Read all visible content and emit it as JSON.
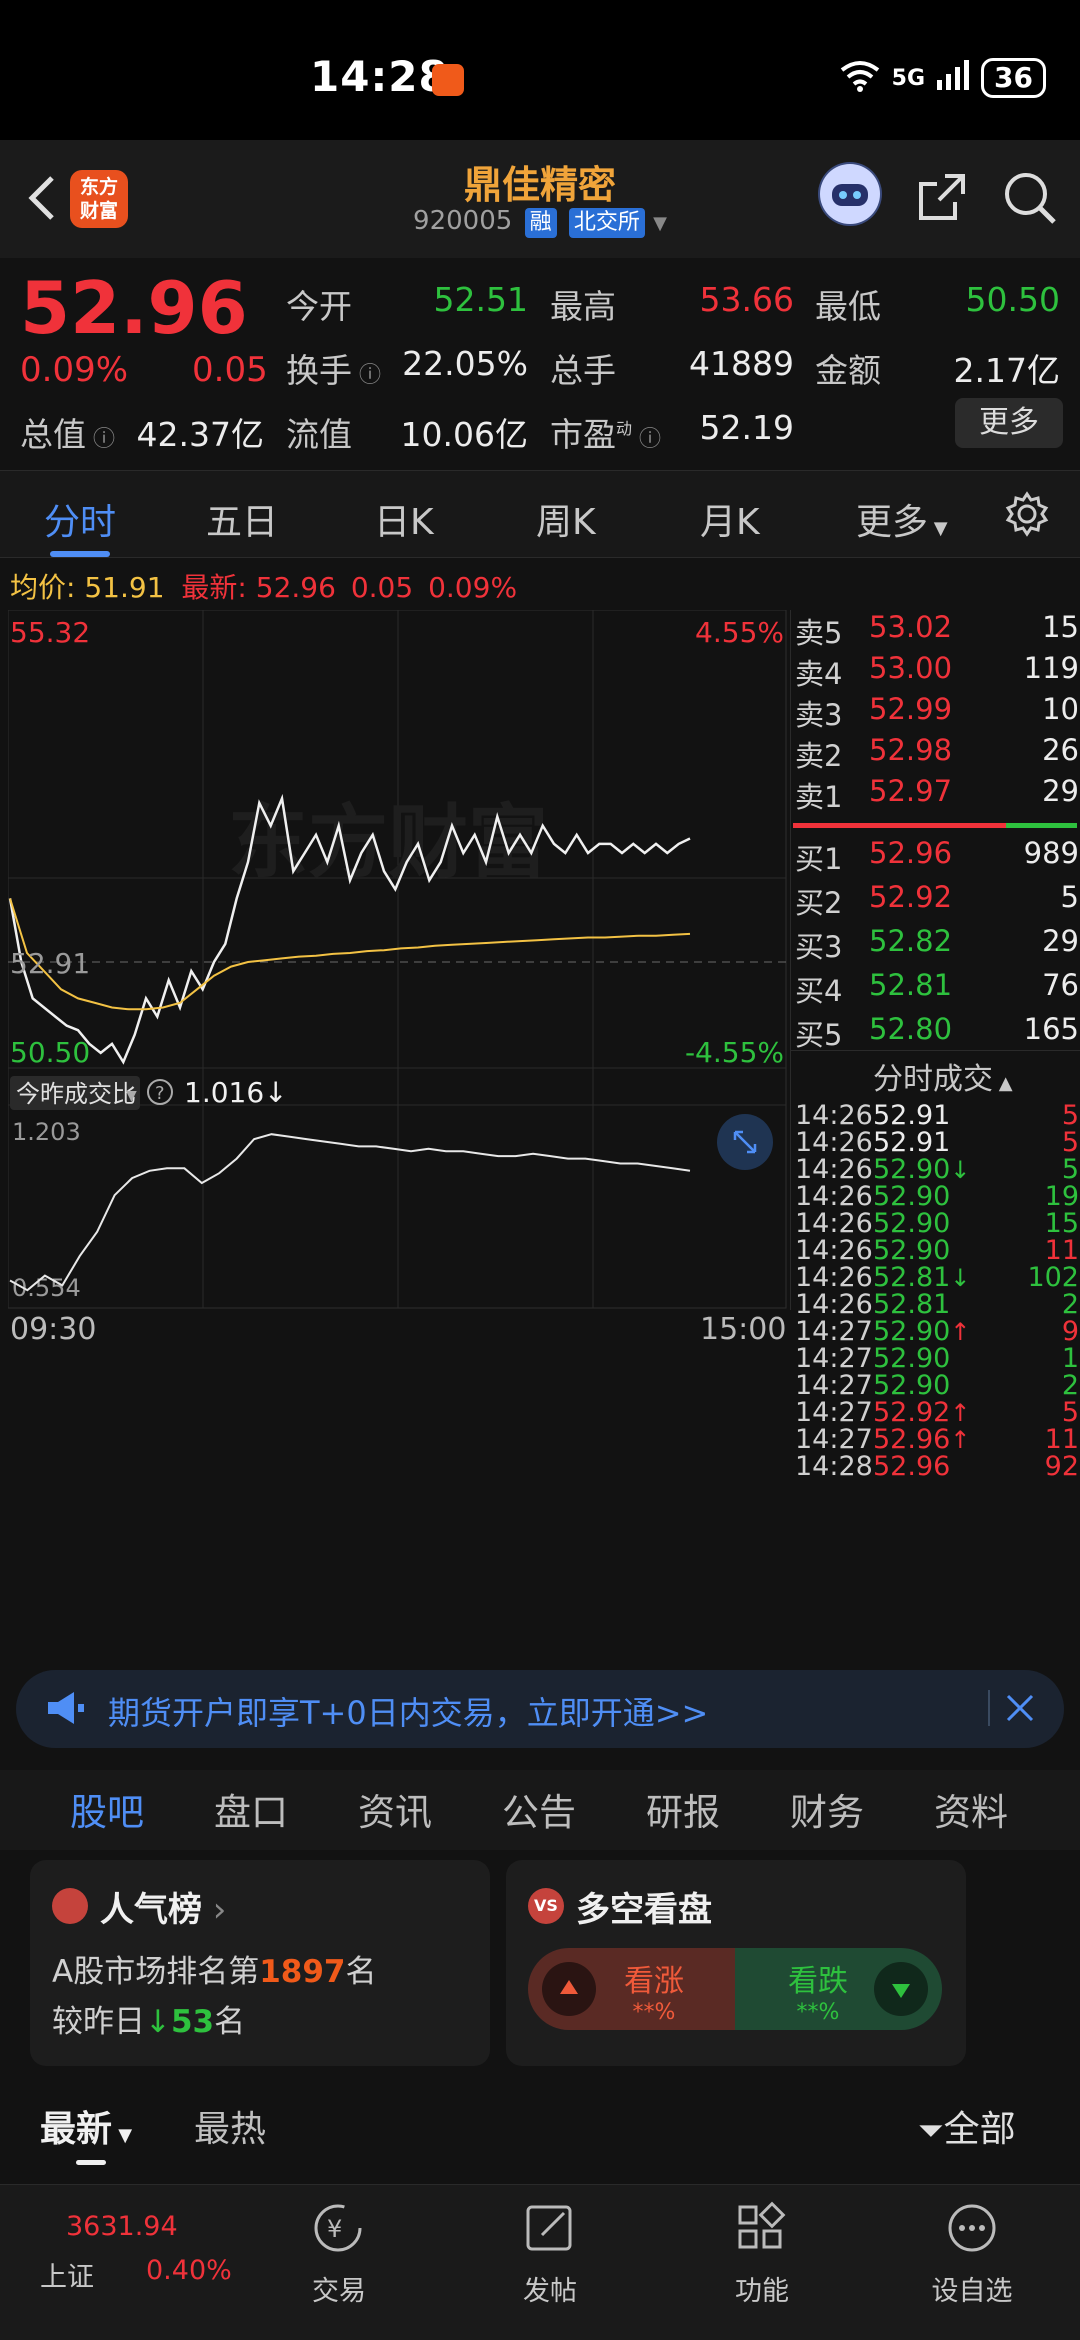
{
  "status_bar": {
    "time": "14:28",
    "network": "5G",
    "wifi_label": "6",
    "battery": "36"
  },
  "header": {
    "logo_text_1": "东方",
    "logo_text_2": "财富",
    "stock_name": "鼎佳精密",
    "stock_code": "920005",
    "tag_margin": "融",
    "tag_exchange": "北交所"
  },
  "quote": {
    "price": "52.96",
    "change_pct": "0.09%",
    "change": "0.05",
    "open_label": "今开",
    "open": "52.51",
    "high_label": "最高",
    "high": "53.66",
    "low_label": "最低",
    "low": "50.50",
    "turnover_label": "换手",
    "turnover": "22.05%",
    "volume_label": "总手",
    "volume": "41889",
    "amount_label": "金额",
    "amount": "2.17亿",
    "mktcap_label": "总值",
    "mktcap": "42.37亿",
    "float_label": "流值",
    "float_cap": "10.06亿",
    "pe_label": "市盈",
    "pe_sup": "动",
    "pe": "52.19",
    "more_label": "更多"
  },
  "chart_tabs": [
    "分时",
    "五日",
    "日K",
    "周K",
    "月K",
    "更多"
  ],
  "avg_bar": {
    "avg_label": "均价:",
    "avg": "51.91",
    "latest_label": "最新:",
    "latest": "52.96",
    "chg": "0.05",
    "pct": "0.09%"
  },
  "chart_data": {
    "type": "line",
    "title": "",
    "y_max_label": "55.32",
    "y_min_label": "50.50",
    "y_prev_close_label": "52.91",
    "pct_max_label": "4.55%",
    "pct_min_label": "-4.55%",
    "ylim": [
      50.5,
      55.32
    ],
    "x_start_label": "09:30",
    "x_end_label": "15:00",
    "series": [
      {
        "values": [
          52.3,
          51.6,
          51.2,
          51.1,
          51.0,
          50.9,
          50.85,
          50.7,
          50.6,
          50.7,
          50.5,
          50.8,
          51.2,
          51.0,
          51.4,
          51.1,
          51.5,
          51.3,
          51.6,
          51.8,
          52.3,
          52.7,
          53.35,
          53.1,
          53.4,
          52.6,
          52.8,
          53.0,
          52.7,
          53.1,
          52.5,
          52.8,
          53.0,
          52.6,
          52.4,
          52.7,
          52.9,
          52.5,
          52.7,
          53.1,
          52.8,
          53.0,
          52.7,
          53.2,
          52.8,
          53.0,
          52.8,
          53.1,
          52.9,
          52.8,
          53.0,
          52.8,
          52.9,
          52.9,
          52.8,
          52.9,
          52.8,
          52.9,
          52.8,
          52.9,
          52.96
        ]
      },
      {
        "values": [
          52.3,
          51.7,
          51.5,
          51.3,
          51.2,
          51.15,
          51.1,
          51.08,
          51.08,
          51.1,
          51.15,
          51.3,
          51.45,
          51.55,
          51.6,
          51.62,
          51.64,
          51.66,
          51.67,
          51.69,
          51.7,
          51.72,
          51.73,
          51.75,
          51.76,
          51.78,
          51.79,
          51.8,
          51.81,
          51.82,
          51.83,
          51.84,
          51.85,
          51.86,
          51.87,
          51.87,
          51.88,
          51.89,
          51.89,
          51.9,
          51.91
        ]
      }
    ]
  },
  "volume_ratio": {
    "label": "今昨成交比",
    "value": "1.016",
    "y_max_label": "1.203",
    "y_min_label": "0.554",
    "values": [
      0.6,
      0.56,
      0.62,
      0.58,
      0.7,
      0.8,
      0.95,
      1.02,
      1.05,
      1.06,
      1.06,
      1.0,
      1.04,
      1.1,
      1.18,
      1.2,
      1.19,
      1.18,
      1.17,
      1.16,
      1.15,
      1.15,
      1.14,
      1.13,
      1.14,
      1.13,
      1.13,
      1.12,
      1.11,
      1.11,
      1.12,
      1.11,
      1.1,
      1.1,
      1.09,
      1.08,
      1.08,
      1.07,
      1.06,
      1.05
    ]
  },
  "order_book": {
    "asks": [
      {
        "label": "卖5",
        "price": "53.02",
        "qty": "15"
      },
      {
        "label": "卖4",
        "price": "53.00",
        "qty": "119"
      },
      {
        "label": "卖3",
        "price": "52.99",
        "qty": "10"
      },
      {
        "label": "卖2",
        "price": "52.98",
        "qty": "26"
      },
      {
        "label": "卖1",
        "price": "52.97",
        "qty": "29"
      }
    ],
    "bids": [
      {
        "label": "买1",
        "price": "52.96",
        "qty": "989"
      },
      {
        "label": "买2",
        "price": "52.92",
        "qty": "5"
      },
      {
        "label": "买3",
        "price": "52.82",
        "qty": "29"
      },
      {
        "label": "买4",
        "price": "52.81",
        "qty": "76"
      },
      {
        "label": "买5",
        "price": "52.80",
        "qty": "165"
      }
    ],
    "ticks_title": "分时成交",
    "ticks": [
      {
        "time": "14:26",
        "price": "52.91",
        "arrow": "",
        "qty": "5",
        "pc": "white",
        "qc": "red"
      },
      {
        "time": "14:26",
        "price": "52.91",
        "arrow": "",
        "qty": "5",
        "pc": "white",
        "qc": "red"
      },
      {
        "time": "14:26",
        "price": "52.90",
        "arrow": "↓",
        "qty": "5",
        "pc": "green",
        "qc": "green"
      },
      {
        "time": "14:26",
        "price": "52.90",
        "arrow": "",
        "qty": "19",
        "pc": "green",
        "qc": "green"
      },
      {
        "time": "14:26",
        "price": "52.90",
        "arrow": "",
        "qty": "15",
        "pc": "green",
        "qc": "green"
      },
      {
        "time": "14:26",
        "price": "52.90",
        "arrow": "",
        "qty": "11",
        "pc": "green",
        "qc": "red"
      },
      {
        "time": "14:26",
        "price": "52.81",
        "arrow": "↓",
        "qty": "102",
        "pc": "green",
        "qc": "green"
      },
      {
        "time": "14:26",
        "price": "52.81",
        "arrow": "",
        "qty": "2",
        "pc": "green",
        "qc": "green"
      },
      {
        "time": "14:27",
        "price": "52.90",
        "arrow": "↑",
        "qty": "9",
        "pc": "green",
        "qc": "red"
      },
      {
        "time": "14:27",
        "price": "52.90",
        "arrow": "",
        "qty": "1",
        "pc": "green",
        "qc": "green"
      },
      {
        "time": "14:27",
        "price": "52.90",
        "arrow": "",
        "qty": "2",
        "pc": "green",
        "qc": "green"
      },
      {
        "time": "14:27",
        "price": "52.92",
        "arrow": "↑",
        "qty": "5",
        "pc": "red",
        "qc": "red"
      },
      {
        "time": "14:27",
        "price": "52.96",
        "arrow": "↑",
        "qty": "11",
        "pc": "red",
        "qc": "red"
      },
      {
        "time": "14:28",
        "price": "52.96",
        "arrow": "",
        "qty": "92",
        "pc": "red",
        "qc": "red"
      }
    ]
  },
  "ad": {
    "text": "期货开户即享T+0日内交易，立即开通>>"
  },
  "section_tabs": [
    "股吧",
    "盘口",
    "资讯",
    "公告",
    "研报",
    "财务",
    "资料"
  ],
  "popularity": {
    "title": "人气榜",
    "rank_prefix": "A股市场排名第",
    "rank": "1897",
    "rank_suffix": "名",
    "change_prefix": "较昨日",
    "change": "53",
    "change_suffix": "名"
  },
  "longshort": {
    "title": "多空看盘",
    "bull": "看涨",
    "bull_val": "**%",
    "bear": "看跌",
    "bear_val": "**%"
  },
  "feed_tabs": {
    "latest": "最新",
    "hot": "最热",
    "filter": "全部"
  },
  "bottom_nav": {
    "index_value": "3631.94",
    "index_name": "上证",
    "index_pct": "0.40%",
    "items": [
      "交易",
      "发帖",
      "功能",
      "设自选"
    ]
  },
  "colors": {
    "up": "#f0323a",
    "down": "#2ec13e",
    "accent": "#4f8ef5",
    "avg": "#f3c244"
  }
}
